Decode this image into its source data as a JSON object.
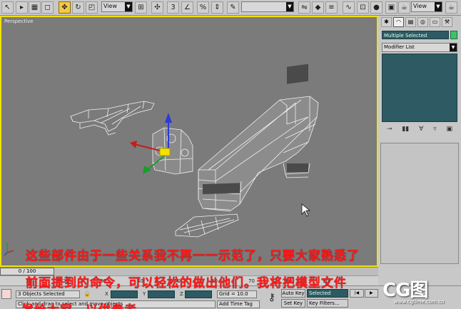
{
  "toolbar": {
    "view_dropdown_1": "View",
    "view_dropdown_2": "View",
    "named_selection": ""
  },
  "viewport": {
    "label": "Perspective"
  },
  "command_panel": {
    "selection_name": "Multiple Selected",
    "modifier_list": "Modifier List",
    "object_color": "#3ec070"
  },
  "captions": [
    "这些部件由于一些关系我不再一一示范了，只要大家熟悉了",
    "前面提到的命令，可以轻松的做出他们。我将把模型文件",
    "发给大家，以供参考。"
  ],
  "time_slider": {
    "frame_text": "0 / 100"
  },
  "track_ticks": [
    "10",
    "20",
    "30",
    "40",
    "50",
    "60",
    "70",
    "80",
    "90"
  ],
  "status": {
    "selection_status": "3 Objects Selected",
    "prompt": "Click and drag to select and move objects",
    "x_label": "X",
    "y_label": "Y",
    "z_label": "Z",
    "grid": "Grid = 10.0",
    "add_time_tag": "Add Time Tag",
    "auto_key": "Auto Key",
    "set_key": "Set Key",
    "key_mode": "Selected",
    "key_filters": "Key Filters..."
  },
  "watermark": {
    "logo": "CG图",
    "url": "www.cgtime.com.cn"
  },
  "colors": {
    "viewport_bg": "#7b7b7b",
    "active_border": "#f1e200",
    "caption": "#ff1a1a",
    "panel_field": "#2d5a63"
  }
}
